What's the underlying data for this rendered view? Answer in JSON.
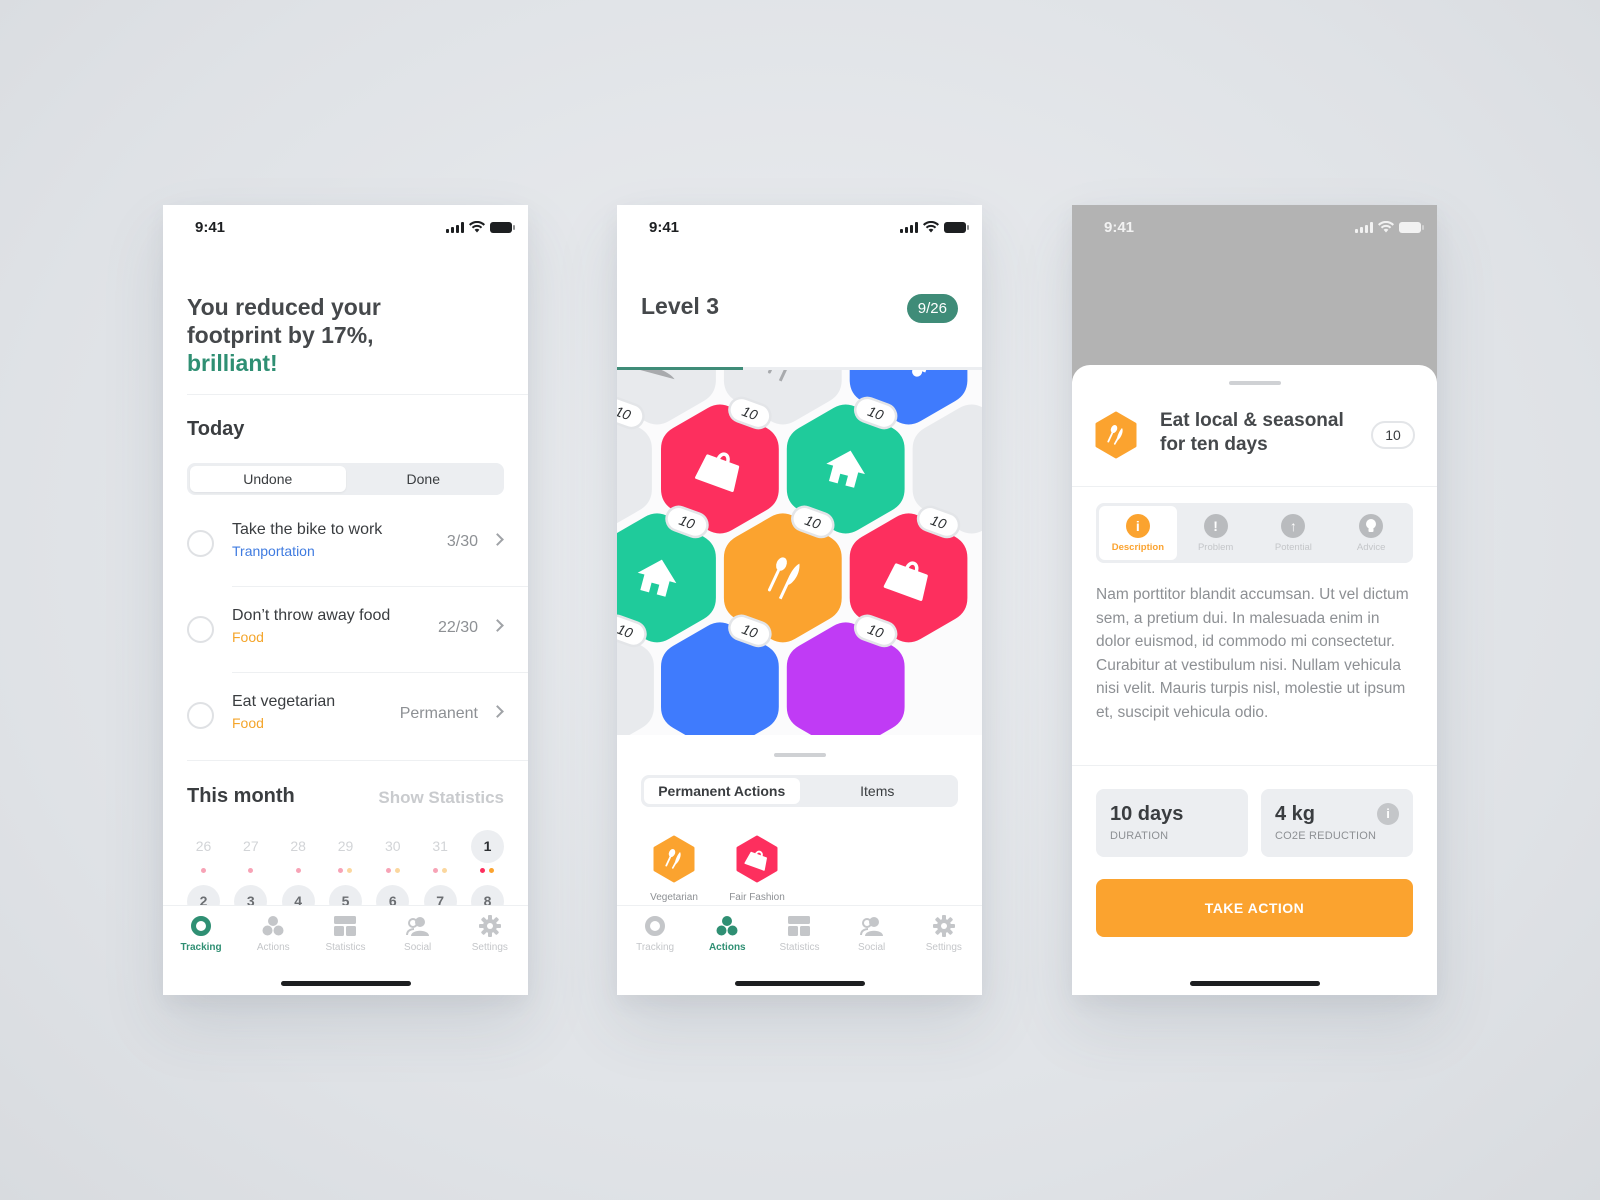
{
  "colors": {
    "brand_green": "#3f8c78",
    "accent_green_text": "#2f8f73",
    "orange": "#fba32f",
    "red": "#fd2f5e",
    "teal": "#1fcb9b",
    "blue": "#3f7bfd",
    "purple": "#c03bf5",
    "locked_gray": "#e8eaed",
    "transport_blue": "#3f7be0",
    "food_orange": "#f4a52b"
  },
  "status_bar": {
    "time": "9:41"
  },
  "tracking_screen": {
    "headline_line1": "You reduced your",
    "headline_line2": "footprint by 17%,",
    "headline_accent": "brilliant!",
    "today_title": "Today",
    "segment": [
      {
        "label": "Undone",
        "active": true
      },
      {
        "label": "Done",
        "active": false
      }
    ],
    "tasks": [
      {
        "name": "Take the bike to work",
        "category": "Tranportation",
        "category_color": "#3f7be0",
        "value": "3/30"
      },
      {
        "name": "Don’t throw away food",
        "category": "Food",
        "category_color": "#f4a52b",
        "value": "22/30"
      },
      {
        "name": "Eat vegetarian",
        "category": "Food",
        "category_color": "#f4a52b",
        "value": "Permanent"
      }
    ],
    "month_title": "This month",
    "show_statistics": "Show Statistics",
    "calendar_week1": [
      {
        "day": "26",
        "dots": [
          "#f7a3b6"
        ]
      },
      {
        "day": "27",
        "dots": [
          "#f7a3b6"
        ]
      },
      {
        "day": "28",
        "dots": [
          "#f7a3b6"
        ]
      },
      {
        "day": "29",
        "dots": [
          "#f7a3b6",
          "#fbd79e"
        ]
      },
      {
        "day": "30",
        "dots": [
          "#f7a3b6",
          "#fbd79e"
        ]
      },
      {
        "day": "31",
        "dots": [
          "#f7a3b6",
          "#fbd79e"
        ]
      },
      {
        "day": "1",
        "dots": [
          "#fd2f5e",
          "#fba32f"
        ],
        "today": true
      }
    ],
    "calendar_week2": [
      "2",
      "3",
      "4",
      "5",
      "6",
      "7",
      "8"
    ]
  },
  "tabbar": {
    "items": [
      {
        "label": "Tracking",
        "icon": "ring-icon"
      },
      {
        "label": "Actions",
        "icon": "hex-cluster-icon"
      },
      {
        "label": "Statistics",
        "icon": "dashboard-icon"
      },
      {
        "label": "Social",
        "icon": "people-icon"
      },
      {
        "label": "Settings",
        "icon": "gear-icon"
      }
    ]
  },
  "actions_screen": {
    "title": "Level 3",
    "badge": "9/26",
    "level_progress": 0.346,
    "hex_tiles": [
      {
        "color": "#e8eaed",
        "icon": "island-icon",
        "locked": true
      },
      {
        "color": "#e8eaed",
        "icon": "cutlery-icon",
        "locked": true
      },
      {
        "color": "#3f7bfd",
        "icon": "car-icon",
        "locked": false
      },
      {
        "color": "#e8eaed",
        "icon": "",
        "locked": true,
        "points": "10"
      },
      {
        "color": "#fd2f5e",
        "icon": "bag-icon",
        "points": "10"
      },
      {
        "color": "#1fcb9b",
        "icon": "house-icon",
        "points": "10"
      },
      {
        "color": "#e8eaed",
        "icon": "",
        "locked": true
      },
      {
        "color": "#1fcb9b",
        "icon": "house-icon",
        "points": "10"
      },
      {
        "color": "#fba32f",
        "icon": "cutlery-icon",
        "points": "10"
      },
      {
        "color": "#fd2f5e",
        "icon": "bag-icon",
        "points": "10"
      },
      {
        "color": "#e8eaed",
        "icon": "",
        "locked": true,
        "points": "10"
      },
      {
        "color": "#3f7bfd",
        "icon": "",
        "points": "10"
      },
      {
        "color": "#c03bf5",
        "icon": "",
        "points": "10"
      }
    ],
    "segment": [
      {
        "label": "Permanent Actions",
        "active": true
      },
      {
        "label": "Items",
        "active": false
      }
    ],
    "permanent": [
      {
        "label": "Vegetarian",
        "color": "#fba32f",
        "icon": "cutlery-icon"
      },
      {
        "label": "Fair Fashion",
        "color": "#fd2f5e",
        "icon": "bag-icon"
      }
    ]
  },
  "detail_screen": {
    "title": "Eat local & seasonal for ten days",
    "points": "10",
    "tabs": [
      {
        "label": "Description",
        "glyph": "i",
        "icon": "info-icon",
        "active": true
      },
      {
        "label": "Problem",
        "glyph": "!",
        "icon": "alert-icon",
        "active": false
      },
      {
        "label": "Potential",
        "glyph": "↑",
        "icon": "arrow-up-icon",
        "active": false
      },
      {
        "label": "Advice",
        "glyph": "●",
        "icon": "lightbulb-icon",
        "active": false
      }
    ],
    "description": "Nam porttitor blandit accumsan. Ut vel dictum sem, a pretium dui. In malesuada enim in dolor euismod, id commodo mi consectetur. Curabitur at vestibulum nisi. Nullam vehicula nisi velit. Mauris turpis nisl, molestie ut ipsum et, suscipit vehicula odio.",
    "duration_value": "10 days",
    "duration_label": "DURATION",
    "reduction_value": "4 kg",
    "reduction_label": "CO2E REDUCTION",
    "cta": "TAKE ACTION"
  }
}
